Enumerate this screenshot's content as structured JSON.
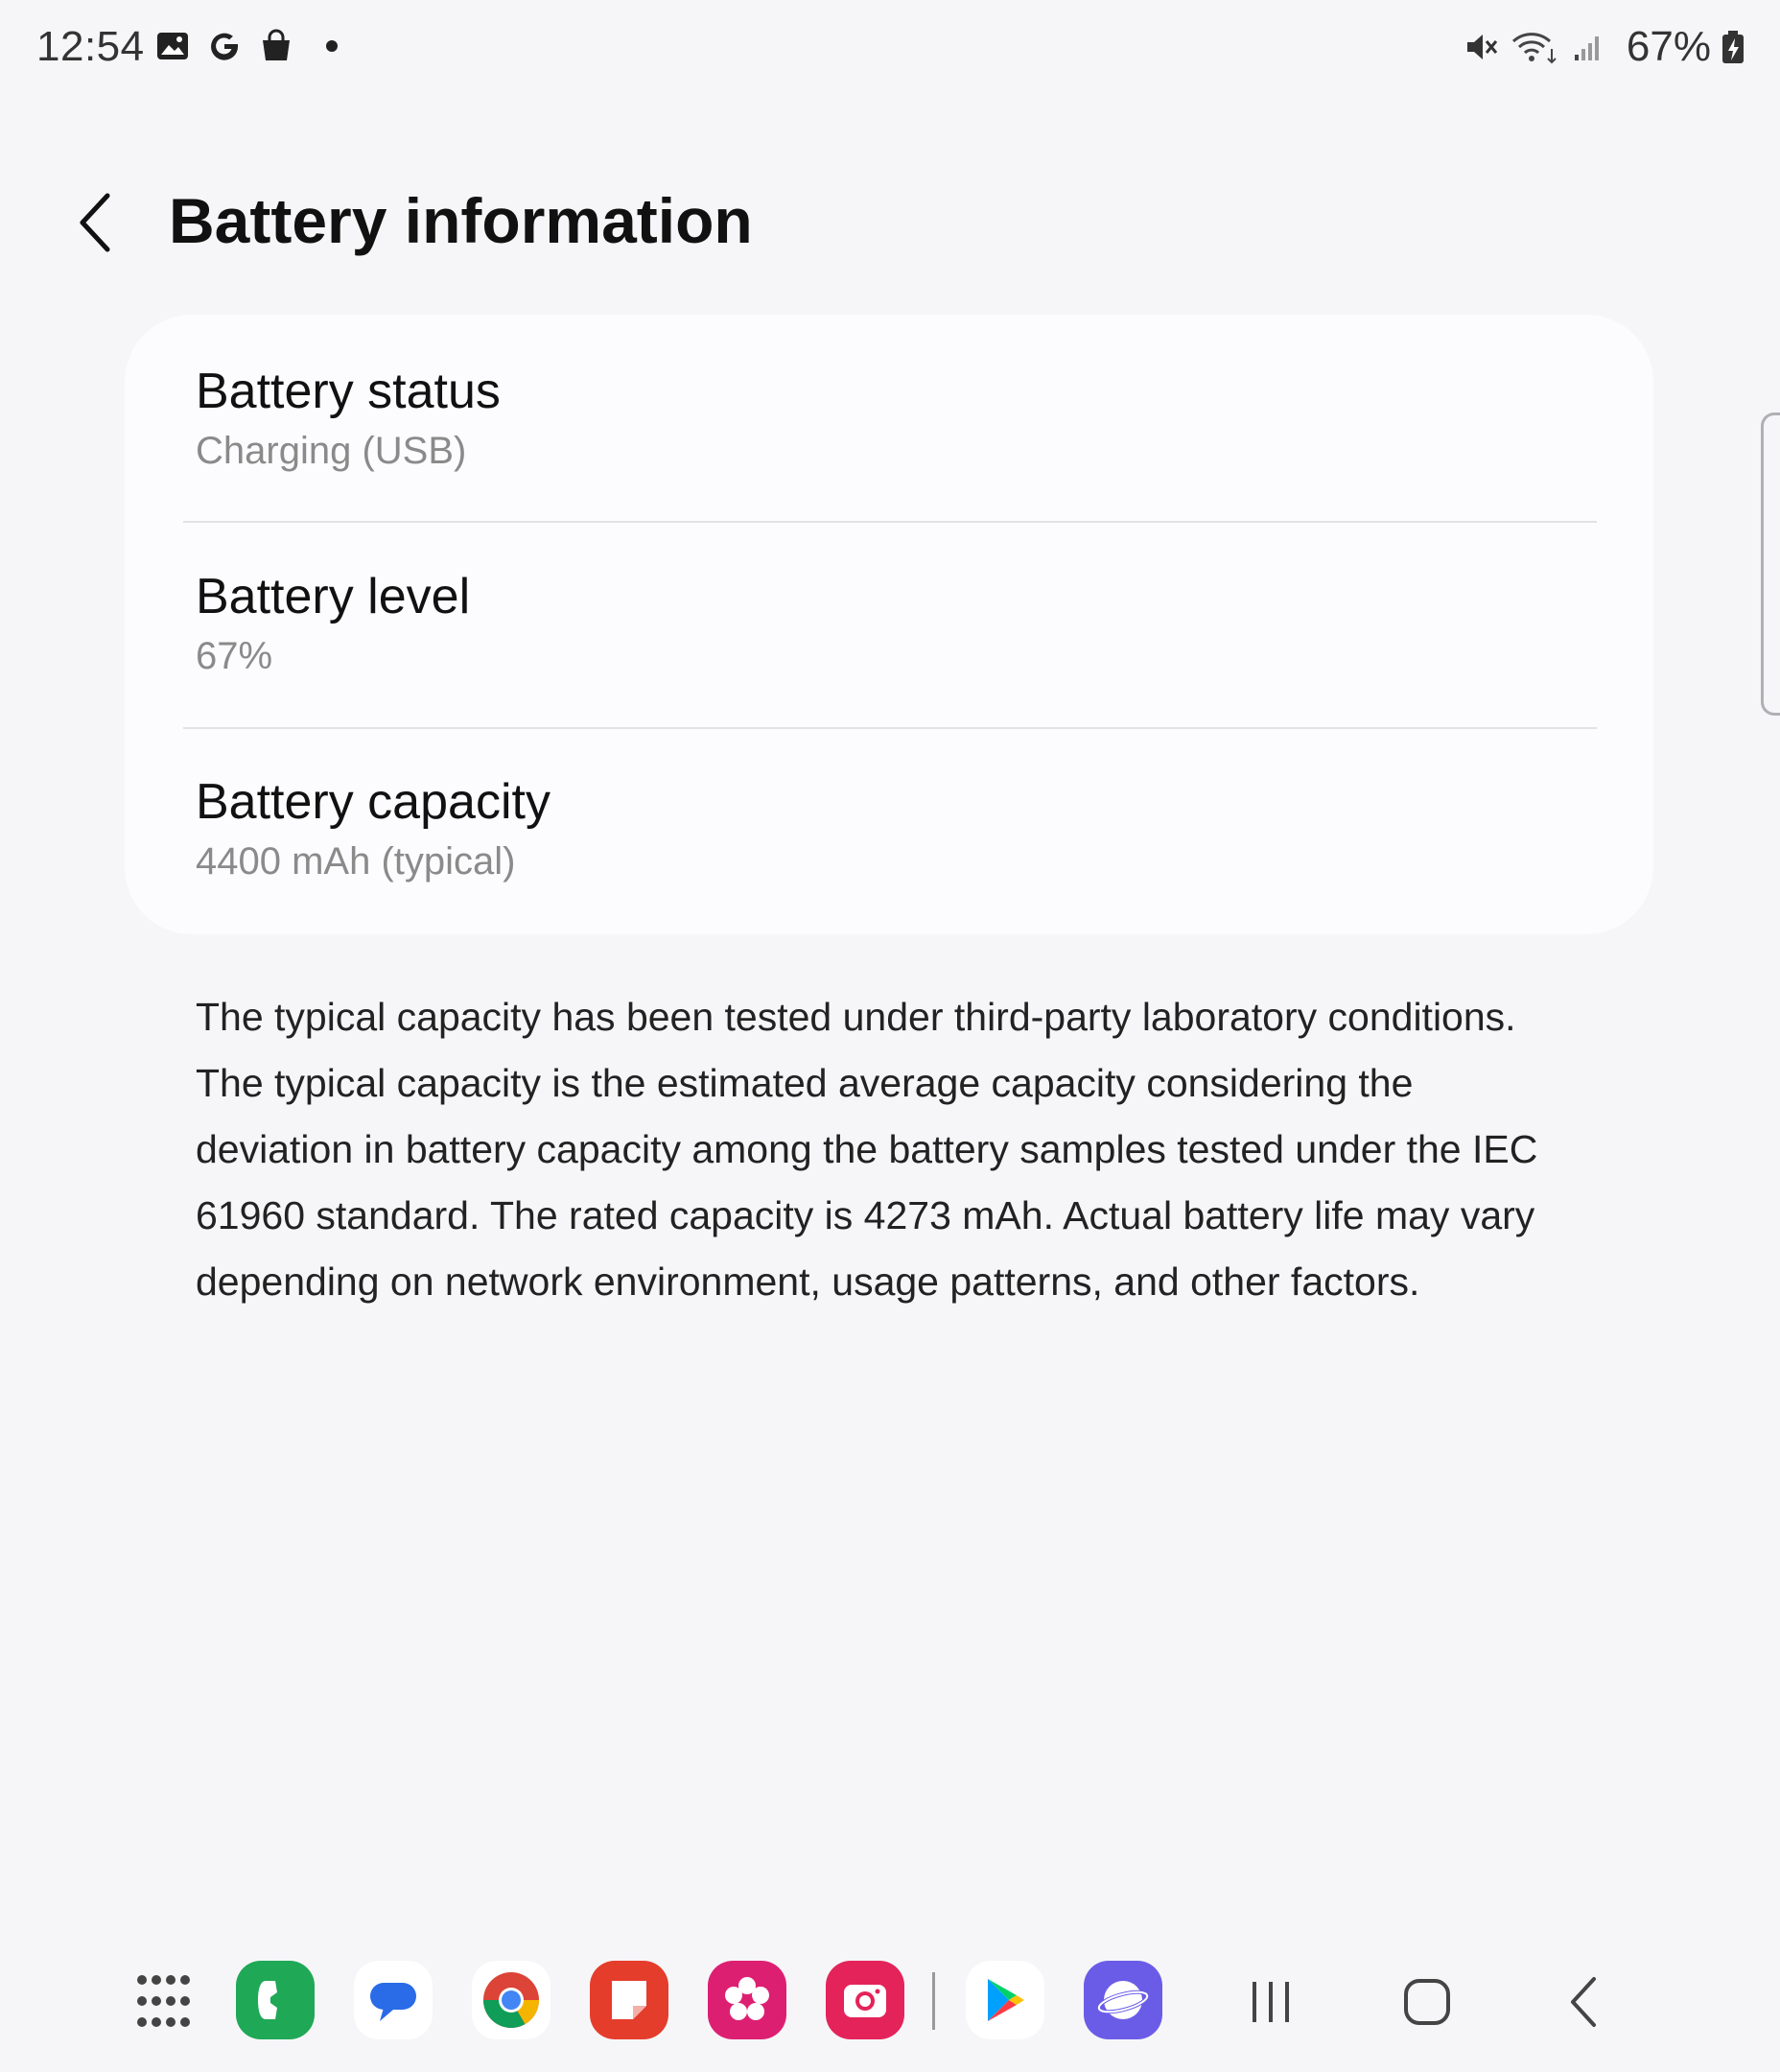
{
  "status_bar": {
    "time": "12:54",
    "left_icons": [
      "gallery-icon",
      "google-icon",
      "shopping-bag-icon",
      "notification-dot"
    ],
    "right_icons": [
      "mute-icon",
      "wifi-icon",
      "signal-icon",
      "battery-charging-icon"
    ],
    "battery_percent": "67%"
  },
  "header": {
    "back_icon": "chevron-left-icon",
    "title": "Battery information"
  },
  "items": [
    {
      "title": "Battery status",
      "value": "Charging (USB)"
    },
    {
      "title": "Battery level",
      "value": "67%"
    },
    {
      "title": "Battery capacity",
      "value": "4400 mAh (typical)"
    }
  ],
  "description": "The typical capacity has been tested under third-party laboratory conditions. The typical capacity is the estimated average capacity considering the deviation in battery capacity among the battery samples tested under the IEC 61960 standard. The rated capacity is 4273 mAh. Actual battery life may vary depending on network environment, usage patterns, and other factors.",
  "taskbar": {
    "apps": [
      {
        "name": "phone",
        "icon": "phone-app-icon",
        "color": "#1fa856"
      },
      {
        "name": "messages",
        "icon": "messages-app-icon",
        "color": "#ffffff"
      },
      {
        "name": "chrome",
        "icon": "chrome-app-icon",
        "color": "#ffffff"
      },
      {
        "name": "notes",
        "icon": "notes-app-icon",
        "color": "#e53d2c"
      },
      {
        "name": "gallery",
        "icon": "gallery-app-icon",
        "color": "#dd1f72"
      },
      {
        "name": "camera",
        "icon": "camera-app-icon",
        "color": "#e4235a"
      },
      {
        "name": "play-store",
        "icon": "play-store-app-icon",
        "color": "#ffffff"
      },
      {
        "name": "internet",
        "icon": "internet-app-icon",
        "color": "#6b5ce7"
      }
    ],
    "nav": [
      "recents-icon",
      "home-icon",
      "back-icon"
    ]
  }
}
